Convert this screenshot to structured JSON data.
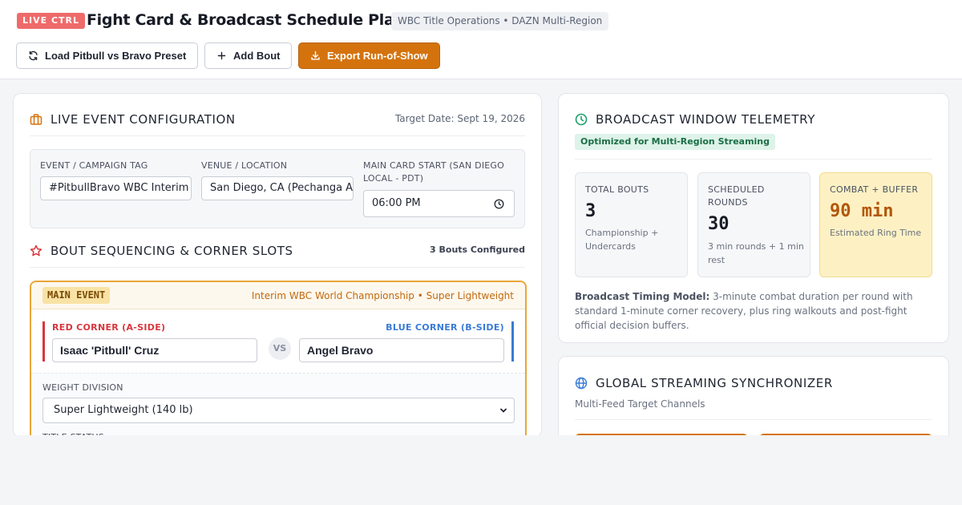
{
  "header": {
    "live_badge": "LIVE CTRL",
    "title": "Fight Card & Broadcast Schedule Planner",
    "org_pill": "WBC Title Operations • DAZN Multi-Region",
    "buttons": {
      "load_preset": "Load Pitbull vs Bravo Preset",
      "add_bout": "Add Bout",
      "export": "Export Run-of-Show"
    }
  },
  "config": {
    "heading": "LIVE EVENT CONFIGURATION",
    "target_date": "Target Date: Sept 19, 2026",
    "fields": {
      "event_tag_label": "EVENT / CAMPAIGN TAG",
      "event_tag_value": "#PitbullBravo WBC Interim Champions",
      "venue_label": "VENUE / LOCATION",
      "venue_value": "San Diego, CA (Pechanga Arena)",
      "start_label": "MAIN CARD START (SAN DIEGO LOCAL - PDT)",
      "start_value": "06:00 PM"
    }
  },
  "bouts": {
    "heading": "BOUT SEQUENCING & CORNER SLOTS",
    "count": "3 Bouts Configured",
    "main": {
      "tag": "MAIN EVENT",
      "title": "Interim WBC World Championship • Super Lightweight",
      "red_label": "RED CORNER (A-SIDE)",
      "red_value": "Isaac 'Pitbull' Cruz",
      "blue_label": "BLUE CORNER (B-SIDE)",
      "blue_value": "Angel Bravo",
      "vs": "VS",
      "weight_label": "WEIGHT DIVISION",
      "weight_value": "Super Lightweight (140 lb)",
      "title_status_label": "TITLE STATUS"
    }
  },
  "telemetry": {
    "heading": "BROADCAST WINDOW TELEMETRY",
    "badge": "Optimized for Multi-Region Streaming",
    "stats": [
      {
        "label": "TOTAL BOUTS",
        "value": "3",
        "sub": "Championship + Undercards"
      },
      {
        "label": "SCHEDULED ROUNDS",
        "value": "30",
        "sub": "3 min rounds + 1 min rest"
      },
      {
        "label": "COMBAT + BUFFER",
        "value": "90 min",
        "sub": "Estimated Ring Time"
      }
    ],
    "model_title": "Broadcast Timing Model:",
    "model_text": "3-minute combat duration per round with standard 1-minute corner recovery, plus ring walkouts and post-fight official decision buffers."
  },
  "sync": {
    "heading": "GLOBAL STREAMING SYNCHRONIZER",
    "subtitle": "Multi-Feed Target Channels"
  },
  "colors": {
    "accent": "#d4730e",
    "live": "#ef6a6a",
    "red_corner": "#d9363e",
    "blue_corner": "#3a7bd5",
    "highlight": "#fdf1c4"
  }
}
